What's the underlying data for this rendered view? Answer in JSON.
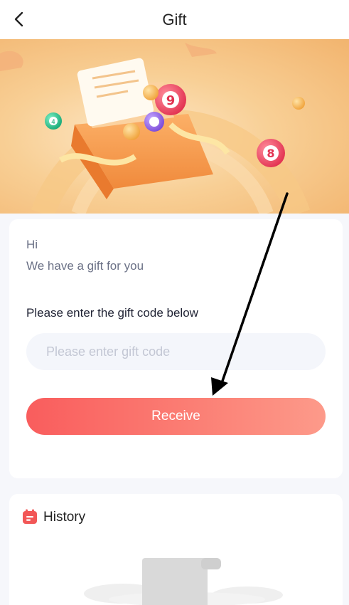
{
  "header": {
    "title": "Gift",
    "back_icon": "chevron-left-icon"
  },
  "banner": {
    "ball_numbers": [
      "4",
      "9",
      "8"
    ]
  },
  "gift_card": {
    "greeting": "Hi",
    "message": "We have a gift for you",
    "code_label": "Please enter the gift code below",
    "code_input": {
      "value": "",
      "placeholder": "Please enter gift code"
    },
    "receive_label": "Receive"
  },
  "history": {
    "title": "History",
    "icon": "calendar-icon"
  },
  "colors": {
    "accent_red": "#f95d5d",
    "button_gradient_end": "#fd9a8a",
    "banner_orange": "#f2b46e"
  }
}
